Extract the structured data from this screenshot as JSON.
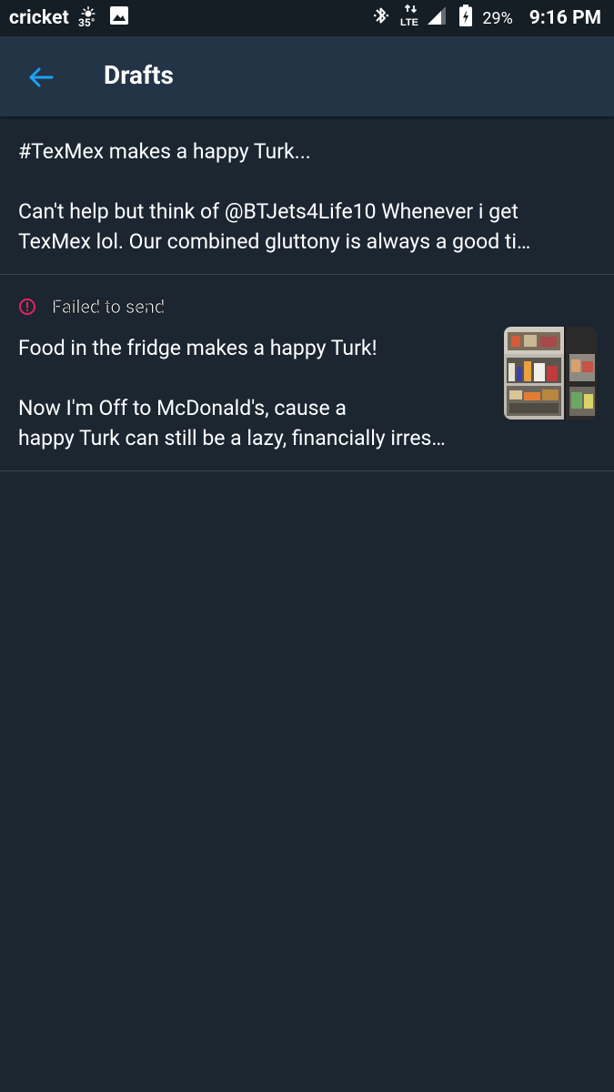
{
  "status_bar": {
    "carrier": "cricket",
    "weather_temp": "35°",
    "weather_icon": "sun-icon",
    "gallery_icon": "image-icon",
    "bluetooth_icon": "bluetooth-icon",
    "network": "LTE",
    "battery_percent": "29%",
    "time": "9:16 PM"
  },
  "app_bar": {
    "title": "Drafts",
    "back_icon": "arrow-left-icon",
    "accent": "#1da1f2"
  },
  "drafts": [
    {
      "text": "#TexMex makes a happy Turk...\n\nCan't help but think of @BTJets4Life10 Whenever i get\nTexMex lol. Our combined gluttony is always a good ti…",
      "failed": false
    },
    {
      "status_label": "Failed to send",
      "status_icon": "alert-circle-icon",
      "status_color": "#e0245e",
      "text": "Food in the fridge makes a happy Turk!\n\nNow I'm Off to McDonald's, cause a\nhappy Turk can still be a lazy, financially irres…",
      "has_thumbnail": true,
      "failed": true
    }
  ],
  "colors": {
    "background": "#1b2631",
    "app_bar": "#243447",
    "status_bar": "#151d25",
    "divider": "#38444d"
  }
}
